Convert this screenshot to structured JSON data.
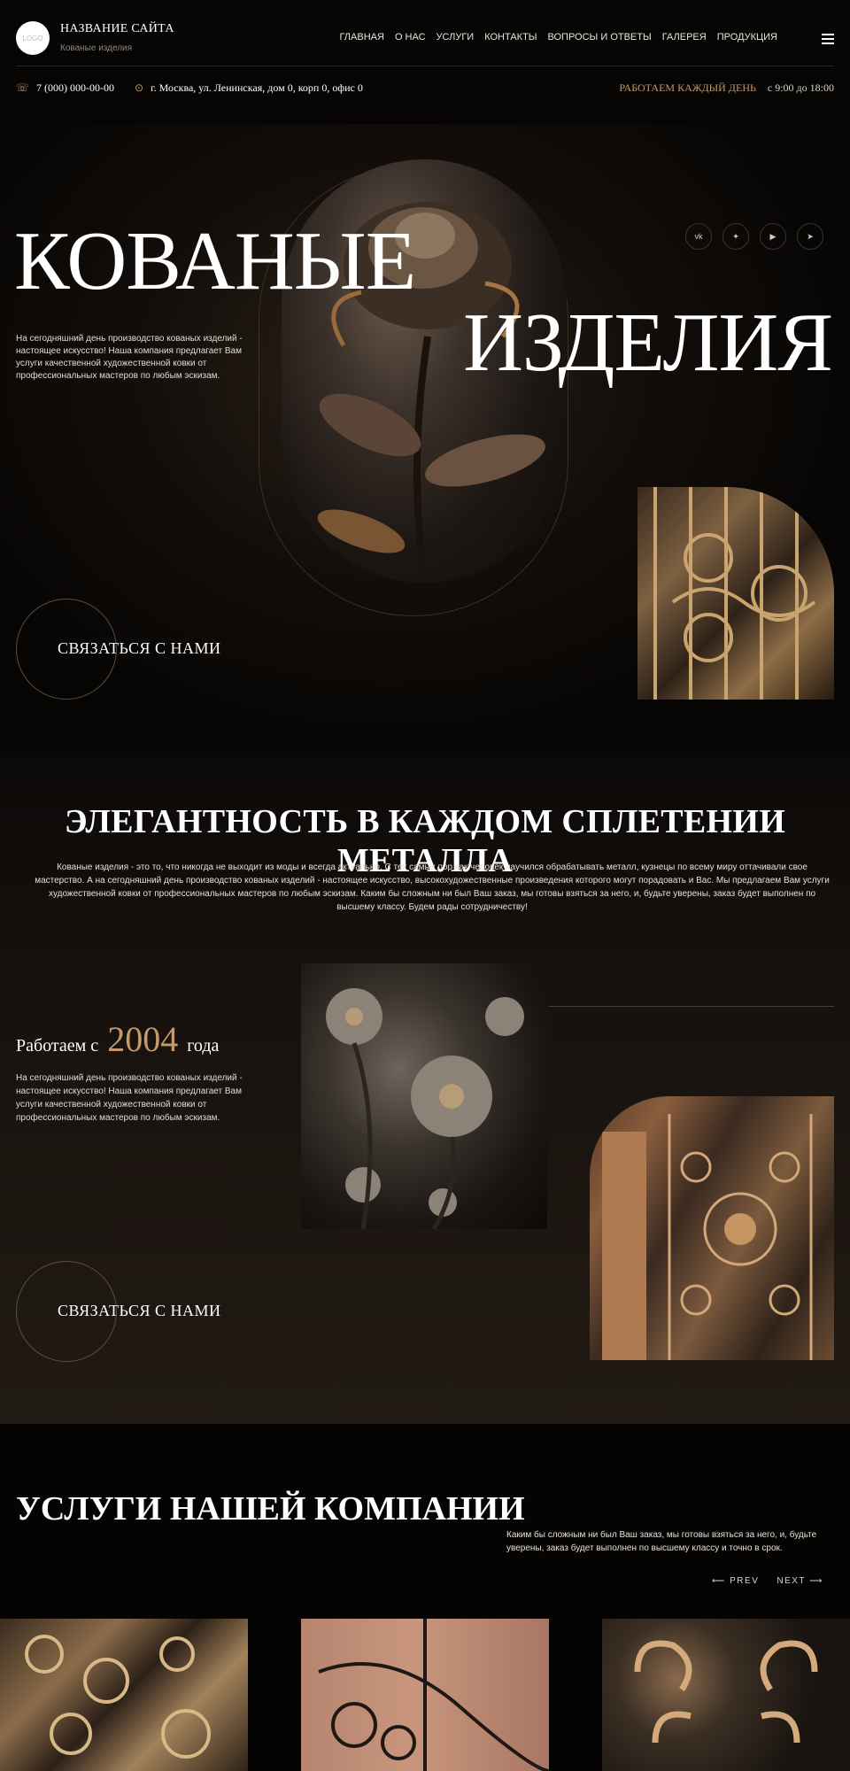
{
  "header": {
    "site_name": "НАЗВАНИЕ САЙТА",
    "site_sub": "Кованые изделия",
    "nav": [
      "ГЛАВНАЯ",
      "О НАС",
      "УСЛУГИ",
      "КОНТАКТЫ",
      "ВОПРОСЫ И ОТВЕТЫ",
      "ГАЛЕРЕЯ",
      "ПРОДУКЦИЯ"
    ],
    "phone": "7 (000) 000-00-00",
    "address": "г. Москва, ул. Ленинская, дом 0, корп 0, офис 0",
    "work_label": "РАБОТАЕМ  КАЖДЫЙ ДЕНЬ",
    "work_hours": "с 9:00 до 18:00"
  },
  "hero": {
    "title_line1": "КОВАНЫЕ",
    "title_line2": "ИЗДЕЛИЯ",
    "text": "На сегодняшний день производство кованых изделий - настоящее искусство! Наша компания предлагает Вам услуги качественной художественной ковки от профессиональных мастеров по любым эскизам.",
    "social": [
      "vk",
      "tw",
      "yt",
      "tg"
    ],
    "cta": "СВЯЗАТЬСЯ С НАМИ"
  },
  "about": {
    "title": "ЭЛЕГАНТНОСТЬ В КАЖДОМ СПЛЕТЕНИИ МЕТАЛЛА",
    "text": "Кованые изделия - это то, что никогда не выходит из моды и всегда актуально. С тех самых пор как человек научился обрабатывать металл, кузнецы по всему миру оттачивали свое мастерство. А на сегодняшний день производство кованых изделий - настоящее искусство, высокохудожественные произведения которого могут порадовать и Вас. Мы предлагаем Вам услуги художественной ковки от профессиональных мастеров по любым эскизам. Каким бы сложным ни был Ваш заказ, мы готовы взяться за него, и, будьте уверены, заказ будет выполнен по высшему классу. Будем рады сотрудничеству!",
    "since_prefix": "Работаем с",
    "since_year": "2004",
    "since_suffix": "года",
    "since_text": "На сегодняшний день производство кованых изделий - настоящее искусство! Наша компания предлагает Вам услуги качественной художественной ковки от профессиональных мастеров по любым эскизам.",
    "cta": "СВЯЗАТЬСЯ С НАМИ"
  },
  "services": {
    "title": "УСЛУГИ НАШЕЙ КОМПАНИИ",
    "text": "Каким бы сложным ни был Ваш заказ, мы готовы взяться за него, и, будьте уверены, заказ будет выполнен по высшему классу и точно в срок.",
    "prev": "PREV",
    "next": "NEXT"
  },
  "colors": {
    "accent": "#c49a68",
    "bg": "#060504"
  }
}
